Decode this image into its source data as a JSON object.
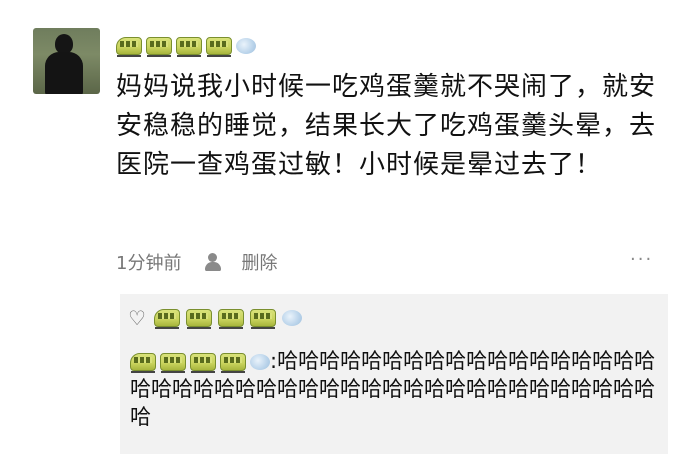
{
  "post": {
    "text": "妈妈说我小时候一吃鸡蛋羹就不哭闹了，就安安稳稳的睡觉，结果长大了吃鸡蛋羹头晕，去医院一查鸡蛋过敏！小时候是晕过去了！",
    "time": "1分钟前",
    "delete_label": "删除",
    "more_label": "···"
  },
  "comment": {
    "separator": ":",
    "text": "哈哈哈哈哈哈哈哈哈哈哈哈哈哈哈哈哈哈哈哈哈哈哈哈哈哈哈哈哈哈哈哈哈哈哈哈哈哈哈哈哈哈哈哈"
  },
  "icons": {
    "like": "heart-outline-icon",
    "author_badge": "train-emoji",
    "steam": "steam-puff-emoji"
  },
  "colors": {
    "comment_bg": "#f2f2f2",
    "meta_text": "#777777"
  }
}
